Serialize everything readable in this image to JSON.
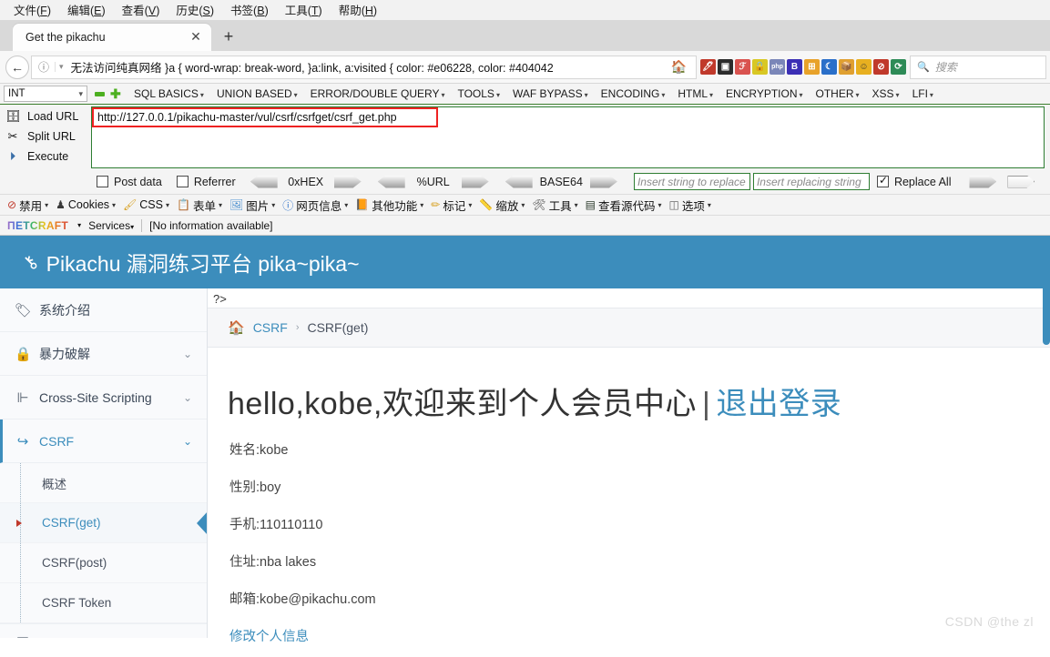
{
  "menubar": {
    "items": [
      {
        "label": "文件",
        "accel": "F"
      },
      {
        "label": "编辑",
        "accel": "E"
      },
      {
        "label": "查看",
        "accel": "V"
      },
      {
        "label": "历史",
        "accel": "S"
      },
      {
        "label": "书签",
        "accel": "B"
      },
      {
        "label": "工具",
        "accel": "T"
      },
      {
        "label": "帮助",
        "accel": "H"
      }
    ]
  },
  "tabstrip": {
    "tab_title": "Get the pikachu",
    "close_glyph": "✕",
    "newtab_glyph": "+"
  },
  "navbar": {
    "back_glyph": "←",
    "info_glyph": "ⓘ",
    "caret_glyph": "▾",
    "url_text": "无法访问纯真网络  }a { word-wrap: break-word, }a:link, a:visited { color: #e06228, color: #404042",
    "home_glyph": "🏠",
    "search_placeholder": "搜索",
    "search_glyph": "🔍",
    "extension_icons": [
      {
        "name": "firebug-icon",
        "glyph": "🖊",
        "color": "#c0392b"
      },
      {
        "name": "screenshot-icon",
        "glyph": "▣",
        "color": "#2c2c2c"
      },
      {
        "name": "fiddler-icon",
        "glyph": "ℱ",
        "color": "#d9534f"
      },
      {
        "name": "lock-icon",
        "glyph": "🔒",
        "color": "#cfc021"
      },
      {
        "name": "php-icon",
        "glyph": "php",
        "color": "#6677aa"
      },
      {
        "name": "bookmark-b-icon",
        "glyph": "B",
        "color": "#3b2fb5"
      },
      {
        "name": "windows-icon",
        "glyph": "⊞",
        "color": "#e8a22a"
      },
      {
        "name": "moon-icon",
        "glyph": "☾",
        "color": "#2a6fc9"
      },
      {
        "name": "box-icon",
        "glyph": "📦",
        "color": "#e0a030"
      },
      {
        "name": "smiley-icon",
        "glyph": "☺",
        "color": "#e8b020"
      },
      {
        "name": "noscript-icon",
        "glyph": "⊘",
        "color": "#c0392b"
      },
      {
        "name": "reload-icon",
        "glyph": "⟳",
        "color": "#2e8b57"
      }
    ]
  },
  "hackbar": {
    "type_select": "INT",
    "select_caret": "▾",
    "minus_glyph": "−",
    "plus_glyph": "+",
    "menus": [
      "SQL BASICS",
      "UNION BASED",
      "ERROR/DOUBLE QUERY",
      "TOOLS",
      "WAF BYPASS",
      "ENCODING",
      "HTML",
      "ENCRYPTION",
      "OTHER",
      "XSS",
      "LFI"
    ],
    "menu_caret": "▾",
    "actions": [
      {
        "label": "Load URL",
        "icon": "load-url-icon",
        "glyph": "🗄"
      },
      {
        "label": "Split URL",
        "icon": "split-url-icon",
        "glyph": "✂"
      },
      {
        "label": "Execute",
        "icon": "execute-icon",
        "glyph": "▶"
      }
    ],
    "url_value": "http://127.0.0.1/pikachu-master/vul/csrf/csrfget/csrf_get.php",
    "post_data_label": "Post data",
    "post_data_checked": false,
    "referrer_label": "Referrer",
    "referrer_checked": false,
    "encoders": [
      "0xHEX",
      "%URL",
      "BASE64"
    ],
    "replace_placeholder": "Insert string to replace",
    "replacing_placeholder": "Insert replacing string",
    "replace_all_label": "Replace All",
    "replace_all_checked": true
  },
  "exttoolbar": {
    "items": [
      {
        "label": "禁用",
        "icon": "disable-icon",
        "glyph": "⊘",
        "color": "#c0392b"
      },
      {
        "label": "Cookies",
        "icon": "cookies-icon",
        "glyph": "♟",
        "color": "#3a3a3a"
      },
      {
        "label": "CSS",
        "icon": "css-icon",
        "glyph": "🖌",
        "color": "#d7a021"
      },
      {
        "label": "表单",
        "icon": "forms-icon",
        "glyph": "📋",
        "color": "#c8972e"
      },
      {
        "label": "图片",
        "icon": "images-icon",
        "glyph": "🖼",
        "color": "#4a8fcf"
      },
      {
        "label": "网页信息",
        "icon": "page-info-icon",
        "glyph": "ⓘ",
        "color": "#2a6fc9"
      },
      {
        "label": "其他功能",
        "icon": "misc-icon",
        "glyph": "📙",
        "color": "#c8972e"
      },
      {
        "label": "标记",
        "icon": "outline-icon",
        "glyph": "✏",
        "color": "#d7a021"
      },
      {
        "label": "缩放",
        "icon": "resize-icon",
        "glyph": "📏",
        "color": "#d7a021"
      },
      {
        "label": "工具",
        "icon": "tools-icon",
        "glyph": "🛠",
        "color": "#4a4a4a"
      },
      {
        "label": "查看源代码",
        "icon": "view-source-icon",
        "glyph": "▤",
        "color": "#2b3a2b"
      },
      {
        "label": "选项",
        "icon": "options-icon",
        "glyph": "⬚",
        "color": "#6a6a6a"
      }
    ],
    "caret": "▾"
  },
  "netcraft": {
    "logo": "ΠETCRAFT",
    "caret": "▾",
    "services_label": "Services",
    "status": "[No information available]"
  },
  "pikachu": {
    "header_title": "Pikachu 漏洞练习平台 pika~pika~",
    "header_icon": "key-icon",
    "sidebar": [
      {
        "label": "系统介绍",
        "icon": "tag-icon",
        "glyph": "🏷",
        "chevron": "",
        "active": false
      },
      {
        "label": "暴力破解",
        "icon": "lock-icon",
        "glyph": "🔒",
        "chevron": "⌄",
        "active": false
      },
      {
        "label": "Cross-Site Scripting",
        "icon": "xss-icon",
        "glyph": "⊨",
        "chevron": "⌄",
        "active": false
      },
      {
        "label": "CSRF",
        "icon": "csrf-icon",
        "glyph": "↪",
        "chevron": "⌄",
        "active": true
      }
    ],
    "sidebar_sub": [
      {
        "label": "概述",
        "current": false
      },
      {
        "label": "CSRF(get)",
        "current": true
      },
      {
        "label": "CSRF(post)",
        "current": false
      },
      {
        "label": "CSRF Token",
        "current": false
      }
    ],
    "php_tail": "?>",
    "breadcrumb": {
      "home_icon": "home-icon",
      "parent": "CSRF",
      "separator": "›",
      "current": "CSRF(get)"
    },
    "greeting": "hello,kobe,欢迎来到个人会员中心",
    "greeting_divider": "|",
    "logout_label": "退出登录",
    "info": [
      "姓名:kobe",
      "性别:boy",
      "手机:110110110",
      "住址:nba lakes",
      "邮箱:kobe@pikachu.com"
    ],
    "edit_link": "修改个人信息"
  },
  "watermark": "CSDN @the zl",
  "colors": {
    "accent": "#3c8dbc",
    "hackbar_green": "#2e7d32",
    "url_highlight_red": "#ee2222"
  }
}
